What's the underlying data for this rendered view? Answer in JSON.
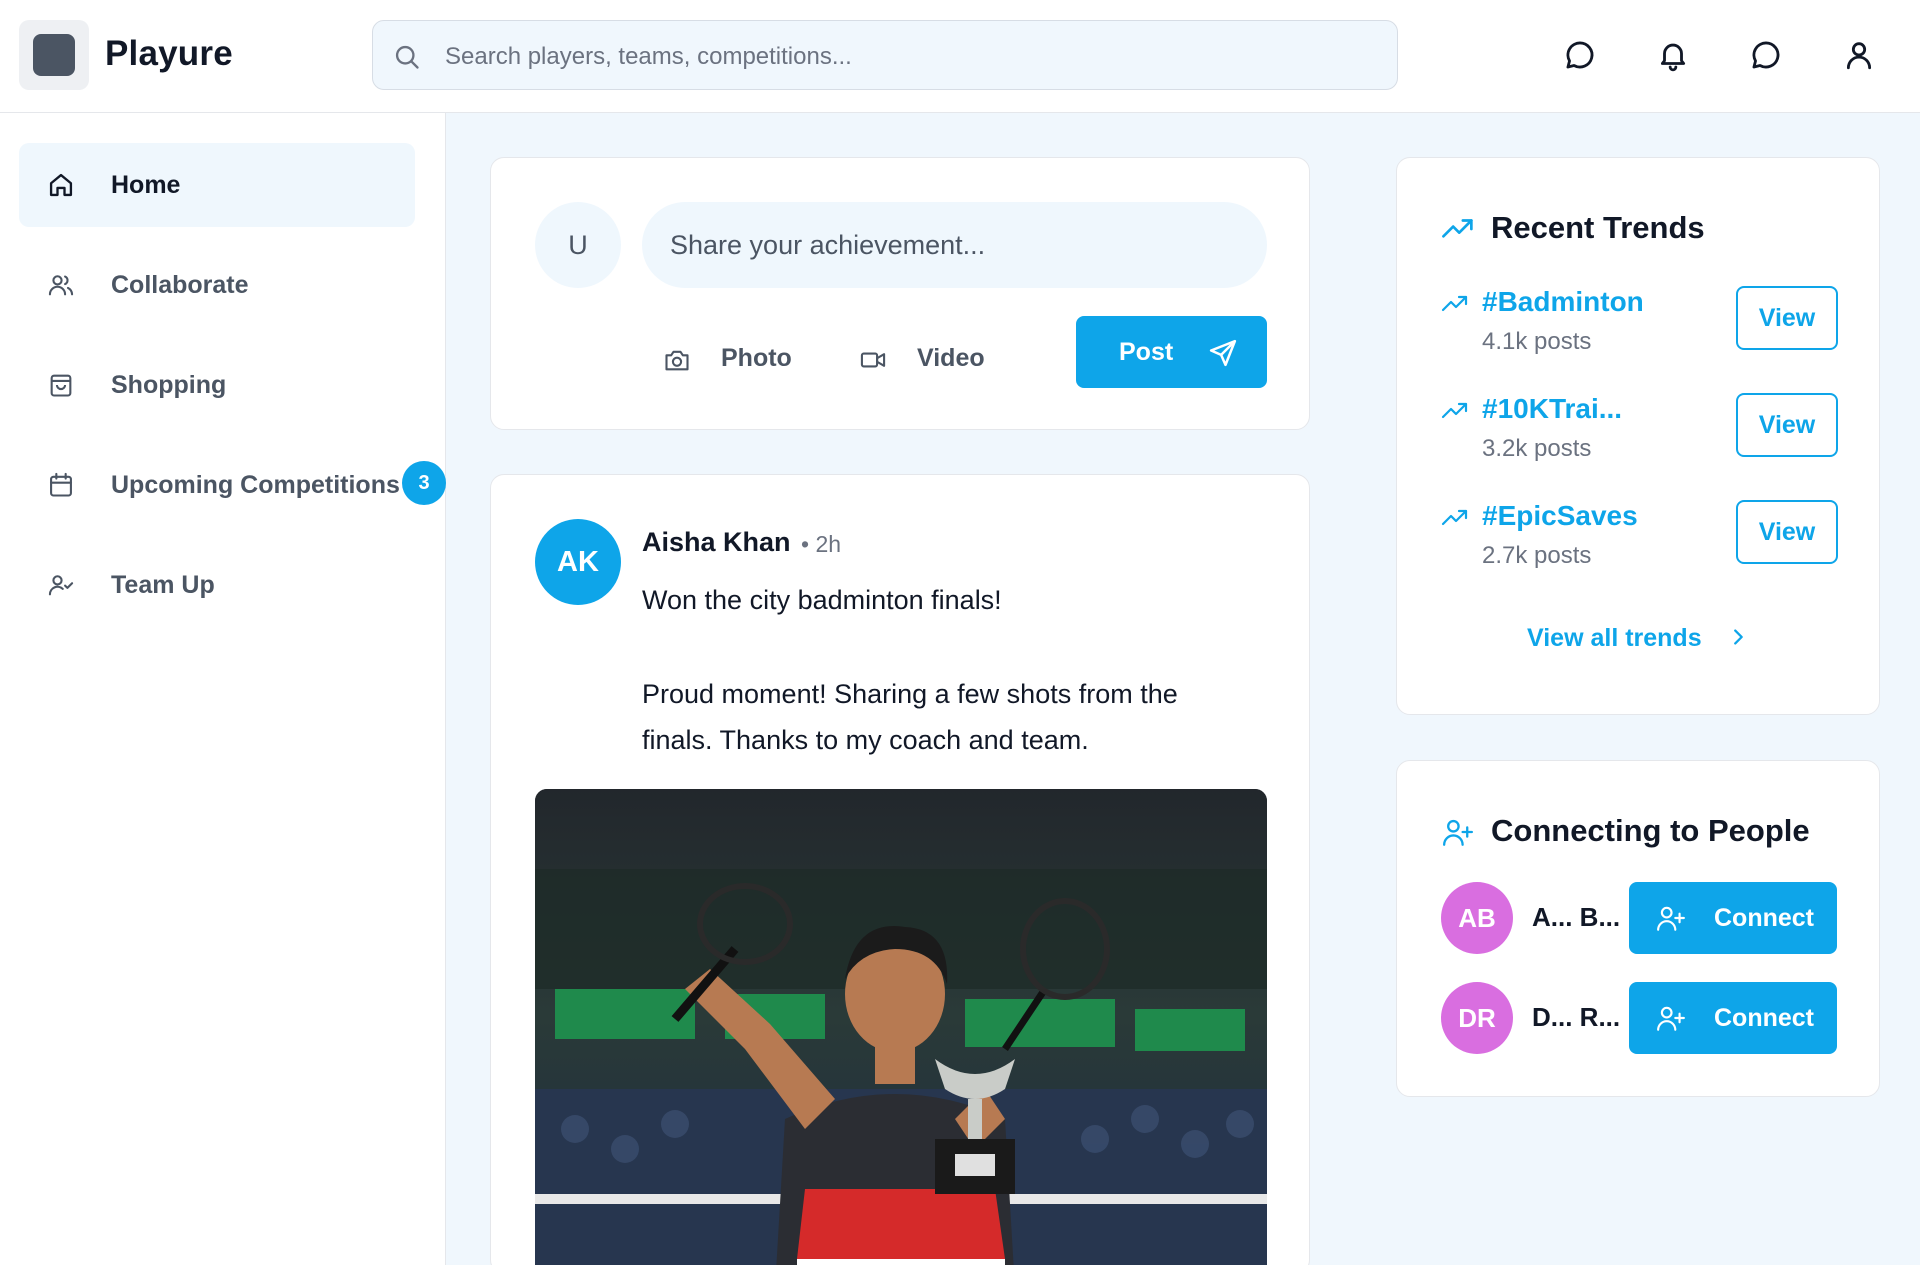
{
  "header": {
    "brand": "Playure",
    "search_placeholder": "Search players, teams, competitions...",
    "icons": [
      "message-icon",
      "bell-icon",
      "chat-icon",
      "user-icon"
    ]
  },
  "sidebar": {
    "items": [
      {
        "label": "Home",
        "icon": "home-icon",
        "active": true
      },
      {
        "label": "Collaborate",
        "icon": "users-icon"
      },
      {
        "label": "Shopping",
        "icon": "shopping-bag-icon"
      },
      {
        "label": "Upcoming Competitions",
        "icon": "calendar-icon",
        "badge": "3"
      },
      {
        "label": "Team Up",
        "icon": "user-check-icon"
      }
    ]
  },
  "composer": {
    "avatar_initial": "U",
    "placeholder": "Share your achievement...",
    "photo_label": "Photo",
    "video_label": "Video",
    "post_label": "Post"
  },
  "post": {
    "avatar_initials": "AK",
    "author": "Aisha Khan",
    "time": "• 2h",
    "title": "Won the city badminton finals!",
    "body": "Proud moment! Sharing a few shots from the finals. Thanks to my coach and team."
  },
  "trends": {
    "title": "Recent Trends",
    "items": [
      {
        "tag": "#Badminton",
        "count": "4.1k posts",
        "action": "View"
      },
      {
        "tag": "#10KTrai...",
        "count": "3.2k posts",
        "action": "View"
      },
      {
        "tag": "#EpicSaves",
        "count": "2.7k posts",
        "action": "View"
      }
    ],
    "view_all": "View all trends"
  },
  "people": {
    "title": "Connecting to People",
    "items": [
      {
        "initials": "AB",
        "name": "A... B...",
        "action": "Connect",
        "color": "#d96ee0"
      },
      {
        "initials": "DR",
        "name": "D... R...",
        "action": "Connect",
        "color": "#d96ee0"
      }
    ]
  },
  "colors": {
    "accent": "#0ea5e9",
    "background": "#f0f7fd"
  }
}
